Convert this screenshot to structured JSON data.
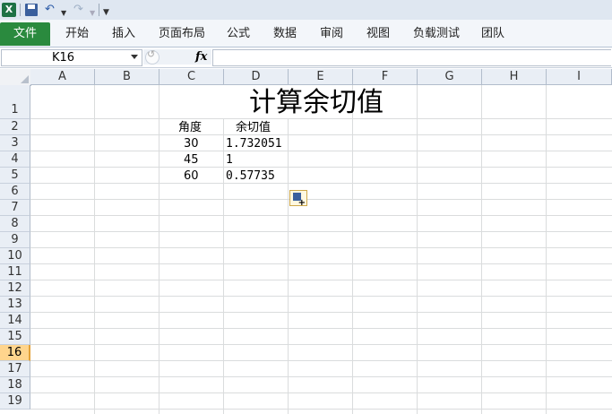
{
  "qat": {
    "app_icon": "excel-icon",
    "save_icon": "save-icon",
    "undo_icon": "undo-icon",
    "redo_icon": "redo-icon",
    "customize_icon": "customize-qat-icon"
  },
  "ribbon": {
    "file_tab": "文件",
    "tabs": [
      "开始",
      "插入",
      "页面布局",
      "公式",
      "数据",
      "审阅",
      "视图",
      "负载测试",
      "团队"
    ]
  },
  "formula_bar": {
    "name_box": "K16",
    "fx_label": "fx",
    "formula": ""
  },
  "sheet": {
    "columns": [
      "A",
      "B",
      "C",
      "D",
      "E",
      "F",
      "G",
      "H",
      "I"
    ],
    "rows": [
      "1",
      "2",
      "3",
      "4",
      "5",
      "6",
      "7",
      "8",
      "9",
      "10",
      "11",
      "12",
      "13",
      "14",
      "15",
      "16",
      "17",
      "18",
      "19"
    ],
    "selected_row": "16",
    "title": "计算余切值",
    "header_angle": "角度",
    "header_cot": "余切值",
    "data": [
      {
        "angle": "30",
        "cot": "1.732051"
      },
      {
        "angle": "45",
        "cot": "1"
      },
      {
        "angle": "60",
        "cot": "0.57735"
      }
    ]
  },
  "paste_options_icon": "paste-options-icon"
}
